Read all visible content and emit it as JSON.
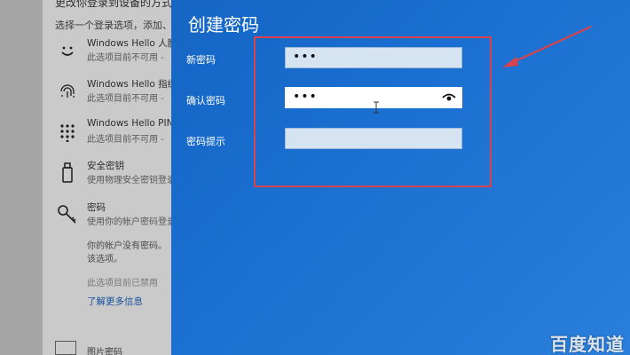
{
  "left_panel": {
    "heading": "更改你登录到设备的方式",
    "choose_text": "选择一个登录选项，添加、",
    "options": [
      {
        "icon": "face-smile-icon",
        "title": "Windows Hello 人脸",
        "subtitle": "此选项目前不可用 - "
      },
      {
        "icon": "fingerprint-icon",
        "title": "Windows Hello 指纹",
        "subtitle": "此选项目前不可用 - "
      },
      {
        "icon": "keypad-pin-icon",
        "title": "Windows Hello PIN",
        "subtitle": "此选项目前不可用 - "
      },
      {
        "icon": "usb-key-icon",
        "title": "安全密钥",
        "subtitle": "使用物理安全密钥登录"
      },
      {
        "icon": "key-icon",
        "title": "密码",
        "subtitle": "使用你的帐户密码登录"
      }
    ],
    "password_note_1": "你的帐户没有密码。",
    "password_note_2": "该选项。",
    "disabled_note": "此选项目前已禁用",
    "learn_more": "了解更多信息",
    "bottom_item": "图片密码"
  },
  "dialog": {
    "title": "创建密码",
    "fields": [
      {
        "label": "新密码",
        "value": "•••",
        "active": false
      },
      {
        "label": "确认密码",
        "value": "•••",
        "active": true,
        "has_reveal": true
      },
      {
        "label": "密码提示",
        "value": "",
        "active": false
      }
    ]
  },
  "annotation": {
    "color": "#d9424a"
  },
  "watermark": "百度知道"
}
